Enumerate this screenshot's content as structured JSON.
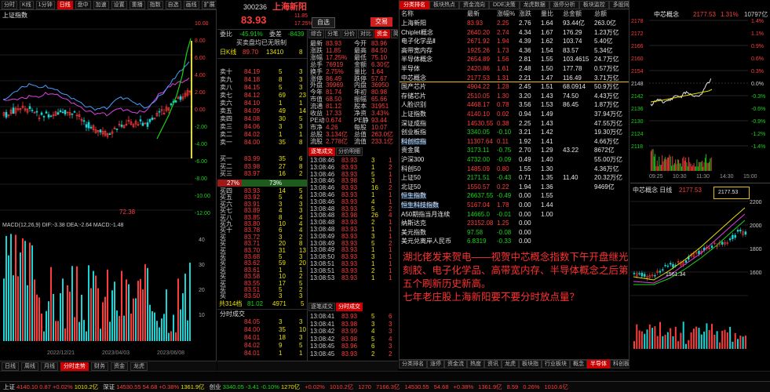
{
  "left": {
    "toolbar": [
      "分时",
      "K线",
      "1分钟",
      "日线",
      "盘中",
      "加速",
      "设置",
      "重播",
      "指数",
      "自选",
      "画线",
      "扩展",
      "分析"
    ],
    "chart_title": "上证指数",
    "scale_right": [
      "10.00",
      "8.00",
      "6.00",
      "4.00",
      "2.00",
      "0.00",
      "-2.00",
      "-4.00",
      "-6.00",
      "-8.00",
      "-10.00",
      "-12.00"
    ],
    "low_label": "72.38",
    "indicator_line": "MACD(12,26,9)  DIF:-3.38  DEA:-2.64  MACD:-1.48",
    "vol_scale": [
      "40",
      "30",
      "20",
      "10"
    ],
    "date_row": [
      "2022/12/21",
      "2023/04/03",
      "2023/06/08"
    ],
    "bottom_tabs": [
      "日线",
      "周线",
      "月线",
      "分时走势",
      "财务",
      "资金",
      "龙虎"
    ]
  },
  "quote": {
    "code": "300236",
    "name": "上海新阳",
    "price": "83.93",
    "change": "11.85",
    "pct": "17.25%",
    "btn_add": "自选",
    "btn_trade": "交易",
    "sub_tabs": [
      "综合",
      "分笔",
      "分价",
      "对比",
      "资金",
      "简况"
    ],
    "ratio_label": "委比",
    "ratio_value": "-45.91%",
    "diff_label": "委差",
    "diff_value": "-8439",
    "top_note": "买卖盘均已无限制",
    "kline_label": "日K线",
    "kline_val": "89.70",
    "kline_vol": "13410",
    "kline_n": "8",
    "asks": [
      {
        "l": "卖十",
        "p": "84.19",
        "v": "5",
        "n": "3"
      },
      {
        "l": "卖九",
        "p": "84.18",
        "v": "8",
        "n": "3"
      },
      {
        "l": "卖八",
        "p": "84.15",
        "v": "5",
        "n": "3"
      },
      {
        "l": "卖七",
        "p": "84.12",
        "v": "69",
        "n": "23"
      },
      {
        "l": "卖六",
        "p": "84.10",
        "v": "1",
        "n": "1"
      },
      {
        "l": "卖五",
        "p": "84.09",
        "v": "49",
        "n": "14"
      },
      {
        "l": "卖四",
        "p": "84.08",
        "v": "30",
        "n": "5"
      },
      {
        "l": "卖三",
        "p": "84.06",
        "v": "3",
        "n": "3"
      },
      {
        "l": "卖二",
        "p": "84.02",
        "v": "1",
        "n": "1"
      },
      {
        "l": "卖一",
        "p": "84.00",
        "v": "35",
        "n": "8"
      }
    ],
    "mid": [
      {
        "l": "买一",
        "p": "83.99",
        "v": "35",
        "n": "6"
      },
      {
        "l": "买二",
        "p": "83.98",
        "v": "27",
        "n": "8"
      },
      {
        "l": "买三",
        "p": "83.97",
        "v": "16",
        "n": "2"
      }
    ],
    "pct_left": "27%",
    "pct_right": "73%",
    "bids": [
      {
        "l": "买四",
        "p": "83.93",
        "v": "14",
        "n": "5"
      },
      {
        "l": "买五",
        "p": "83.92",
        "v": "5",
        "n": "4"
      },
      {
        "l": "买六",
        "p": "83.91",
        "v": "3",
        "n": "3"
      },
      {
        "l": "买七",
        "p": "83.89",
        "v": "4",
        "n": "3"
      },
      {
        "l": "买八",
        "p": "83.85",
        "v": "8",
        "n": "4"
      },
      {
        "l": "买九",
        "p": "83.80",
        "v": "10",
        "n": "4"
      },
      {
        "l": "买十",
        "p": "83.78",
        "v": "6",
        "n": "4"
      },
      {
        "l": "买",
        "p": "83.72",
        "v": "3",
        "n": "2"
      },
      {
        "l": "买",
        "p": "83.71",
        "v": "20",
        "n": "8"
      },
      {
        "l": "买",
        "p": "83.70",
        "v": "31",
        "n": "13"
      },
      {
        "l": "买",
        "p": "83.68",
        "v": "5",
        "n": "3"
      },
      {
        "l": "买",
        "p": "83.62",
        "v": "59",
        "n": "20"
      },
      {
        "l": "买",
        "p": "83.61",
        "v": "1",
        "n": "1"
      },
      {
        "l": "买",
        "p": "83.58",
        "v": "10",
        "n": "2"
      },
      {
        "l": "买",
        "p": "83.55",
        "v": "17",
        "n": "5"
      },
      {
        "l": "买",
        "p": "83.51",
        "v": "5",
        "n": "2"
      },
      {
        "l": "买",
        "p": "83.50",
        "v": "3",
        "n": "3"
      }
    ],
    "total_label": "共314档",
    "total_p": "81.02",
    "total_v": "4971",
    "total_n": "5",
    "stats": [
      {
        "a": "最新",
        "b": "83.93",
        "c": "今开",
        "d": "83.96"
      },
      {
        "a": "涨跌",
        "b": "11.85",
        "c": "最高",
        "d": "84.50"
      },
      {
        "a": "涨幅",
        "b": "17.25%",
        "c": "最低",
        "d": "75.10"
      },
      {
        "a": "总手",
        "b": "76919",
        "c": "金额",
        "d": "6.30亿"
      },
      {
        "a": "换手",
        "b": "2.75%",
        "c": "量比",
        "d": "1.64"
      },
      {
        "a": "涨停",
        "b": "86.49",
        "c": "跌停",
        "d": "57.67"
      },
      {
        "a": "外盘",
        "b": "39969",
        "c": "内盘",
        "d": "36950"
      },
      {
        "a": "今年",
        "b": "81.74",
        "c": "年初",
        "d": "80.98"
      },
      {
        "a": "市值",
        "b": "68.50",
        "c": "振幅",
        "d": "65.66"
      },
      {
        "a": "流通",
        "b": "81.12",
        "c": "股本",
        "d": "31951"
      },
      {
        "a": "收益",
        "b": "17.33",
        "c": "净资",
        "d": "3.43%"
      },
      {
        "a": "PE动",
        "b": "0.674",
        "c": "PE静",
        "d": "93.44"
      },
      {
        "a": "市净",
        "b": "4.26",
        "c": "每股",
        "d": "10.07"
      },
      {
        "a": "总股",
        "b": "3.134亿",
        "c": "总值",
        "d": "263.0亿"
      },
      {
        "a": "流股",
        "b": "2.778亿",
        "c": "流值",
        "d": "233.1亿"
      }
    ],
    "detail_tabs": [
      "逐笔成交",
      "分价明细"
    ],
    "ticks": [
      {
        "t": "13:08:46",
        "p": "83.93",
        "v": "3",
        "n": "1"
      },
      {
        "t": "13:08:46",
        "p": "83.93",
        "v": "1",
        "n": "2"
      },
      {
        "t": "13:08:46",
        "p": "83.93",
        "v": "5",
        "n": "1"
      },
      {
        "t": "13:08:46",
        "p": "83.98",
        "v": "3",
        "n": "1"
      },
      {
        "t": "13:08:46",
        "p": "83.93",
        "v": "16",
        "n": "2"
      },
      {
        "t": "13:08:46",
        "p": "83.93",
        "v": "1",
        "n": "1"
      },
      {
        "t": "13:08:46",
        "p": "83.93",
        "v": "4",
        "n": "1"
      },
      {
        "t": "13:08:48",
        "p": "83.93",
        "v": "5",
        "n": "2"
      },
      {
        "t": "13:08:48",
        "p": "83.98",
        "v": "26",
        "n": "4"
      },
      {
        "t": "13:08:48",
        "p": "83.93",
        "v": "2",
        "n": "1"
      },
      {
        "t": "13:08:48",
        "p": "83.93",
        "v": "1",
        "n": "1"
      },
      {
        "t": "13:08:49",
        "p": "83.93",
        "v": "3",
        "n": "1"
      },
      {
        "t": "13:08:49",
        "p": "83.93",
        "v": "5",
        "n": "2"
      },
      {
        "t": "13:08:49",
        "p": "83.93",
        "v": "1",
        "n": "1"
      },
      {
        "t": "13:08:50",
        "p": "83.93",
        "v": "3",
        "n": "1"
      },
      {
        "t": "13:08:51",
        "p": "83.93",
        "v": "1",
        "n": "1"
      },
      {
        "t": "13:08:51",
        "p": "83.93",
        "v": "2",
        "n": "1"
      },
      {
        "t": "13:08:53",
        "p": "83.93",
        "v": "1",
        "n": "1"
      }
    ],
    "big_tabs": [
      "逐笔成交",
      "分时成交"
    ],
    "big_ticks": [
      {
        "t": "13:08:41",
        "p": "83.93",
        "v": "5",
        "n": "6"
      },
      {
        "t": "13:08:41",
        "p": "83.98",
        "v": "3",
        "n": "3"
      },
      {
        "t": "13:08:42",
        "p": "83.99",
        "v": "4",
        "n": "3"
      },
      {
        "t": "13:08:42",
        "p": "83.98",
        "v": "5",
        "n": "4"
      },
      {
        "t": "13:08:45",
        "p": "83.96",
        "v": "6",
        "n": "3"
      },
      {
        "t": "13:08:45",
        "p": "83.93",
        "v": "2",
        "n": "2"
      },
      {
        "t": "13:08:46",
        "p": "83.93",
        "v": "8",
        "n": "3"
      },
      {
        "t": "13:08:46",
        "p": "83.93",
        "v": "3",
        "n": "4"
      },
      {
        "t": "13:08:47",
        "p": "83.93",
        "v": "4",
        "n": "2"
      },
      {
        "t": "13:08:48",
        "p": "83.93",
        "v": "2",
        "n": "1"
      },
      {
        "t": "13:08:50",
        "p": "83.93",
        "v": "5",
        "n": "3"
      },
      {
        "t": "13:08:53",
        "p": "83.93",
        "v": "1",
        "n": "1"
      }
    ],
    "sub_list_header": "分时成交",
    "sub_list": [
      {
        "t": "13:08",
        "p": "84.05",
        "v": "3",
        "n": "3"
      },
      {
        "t": "13:08",
        "p": "84.00",
        "v": "35",
        "n": "10"
      },
      {
        "t": "13:08",
        "p": "84.01",
        "v": "18",
        "n": "3"
      },
      {
        "t": "13:08",
        "p": "84.02",
        "v": "9",
        "n": "5"
      },
      {
        "t": "13:08",
        "p": "84.01",
        "v": "1",
        "n": "1"
      },
      {
        "t": "13:08",
        "p": "84.01",
        "v": "3",
        "n": "5"
      },
      {
        "t": "13:08",
        "p": "84.03",
        "v": "3",
        "n": "5"
      },
      {
        "t": "13:08",
        "p": "84.04",
        "v": "2",
        "n": "1"
      }
    ]
  },
  "sector": {
    "tabs": [
      "分类排名",
      "板块热点",
      "资金流向",
      "DDE决策",
      "龙虎数据",
      "涨停分析",
      "板块监控",
      "多股同列"
    ],
    "headers": [
      "名称",
      "最新",
      "涨幅%",
      "涨跌",
      "量比",
      "总金额",
      "总额"
    ],
    "rows": [
      {
        "name": "上海新阳",
        "last": "83.93",
        "pct": "2.25",
        "chg": "2.76",
        "ratio": "1.64",
        "amt": "93.44亿",
        "tot": "263.0亿",
        "hl": true
      },
      {
        "name": "Chiplet概念",
        "last": "2640.20",
        "pct": "2.74",
        "chg": "4.34",
        "ratio": "1.67",
        "amt": "176.29",
        "tot": "1.23万亿",
        "hl": true
      },
      {
        "name": "电子化学品Ⅱ",
        "last": "2671.92",
        "pct": "1.94",
        "chg": "4.39",
        "ratio": "1.62",
        "amt": "103.74",
        "tot": "5.40亿",
        "hl": true
      },
      {
        "name": "高带宽内存",
        "last": "1925.26",
        "pct": "1.73",
        "chg": "4.36",
        "ratio": "1.54",
        "amt": "83.57",
        "tot": "5.34亿",
        "hl": true
      },
      {
        "name": "半导体概念",
        "last": "2654.89",
        "pct": "1.56",
        "chg": "2.81",
        "ratio": "1.55",
        "amt": "103.4615",
        "tot": "24.7万亿",
        "hl": true
      },
      {
        "name": "半导体",
        "last": "2420.86",
        "pct": "1.61",
        "chg": "2.48",
        "ratio": "1.50",
        "amt": "177.78",
        "tot": "0.57万亿",
        "hl": true
      },
      {
        "name": "中芯概念",
        "last": "2177.53",
        "pct": "1.31",
        "chg": "2.21",
        "ratio": "1.47",
        "amt": "116.49",
        "tot": "3.71万亿",
        "hl": true
      },
      {
        "name": "国产芯片",
        "last": "4904.22",
        "pct": "1.28",
        "chg": "2.45",
        "ratio": "1.51",
        "amt": "68.0914",
        "tot": "50.9万亿",
        "hl": false
      },
      {
        "name": "存储芯片",
        "last": "2510.05",
        "pct": "1.30",
        "chg": "3.20",
        "ratio": "1.43",
        "amt": "74.50",
        "tot": "4.43万亿",
        "hl": false
      },
      {
        "name": "人脸识别",
        "last": "4468.17",
        "pct": "0.78",
        "chg": "3.56",
        "ratio": "1.53",
        "amt": "86.45",
        "tot": "1.87万亿",
        "hl": false
      },
      {
        "name": "上证指数",
        "last": "4140.10",
        "pct": "0.02",
        "chg": "0.94",
        "ratio": "1.49",
        "amt": "",
        "tot": "37.94万亿",
        "hl": false
      },
      {
        "name": "深证成指",
        "last": "14530.55",
        "pct": "0.38",
        "chg": "2.25",
        "ratio": "1.43",
        "amt": "",
        "tot": "47.55万亿",
        "hl": false
      },
      {
        "name": "创业板指",
        "last": "3340.05",
        "pct": "-0.10",
        "chg": "3.21",
        "ratio": "1.42",
        "amt": "",
        "tot": "19.30万亿",
        "hl": false
      },
      {
        "name": "科创综指",
        "last": "11307.64",
        "pct": "0.11",
        "chg": "1.92",
        "ratio": "1.41",
        "amt": "",
        "tot": "4.66万亿",
        "hl": false
      },
      {
        "name": "贵金属",
        "last": "3173.11",
        "pct": "-0.75",
        "chg": "2.70",
        "ratio": "1.29",
        "amt": "43.22",
        "tot": "8672亿",
        "hl": false
      },
      {
        "name": "沪深300",
        "last": "4732.00",
        "pct": "-0.09",
        "chg": "0.49",
        "ratio": "1.40",
        "amt": "",
        "tot": "55.00万亿",
        "hl": false
      },
      {
        "name": "科创50",
        "last": "1485.09",
        "pct": "0.80",
        "chg": "1.55",
        "ratio": "1.30",
        "amt": "",
        "tot": "4.36万亿",
        "hl": false
      },
      {
        "name": "上证50",
        "last": "2171.51",
        "pct": "-0.43",
        "chg": "0.71",
        "ratio": "1.35",
        "amt": "11.40",
        "tot": "20.32万亿",
        "hl": false
      },
      {
        "name": "北证50",
        "last": "1550.57",
        "pct": "0.22",
        "chg": "1.94",
        "ratio": "1.36",
        "amt": "",
        "tot": "9469亿",
        "hl": false
      },
      {
        "name": "恒生指数",
        "last": "26637.55",
        "pct": "-0.49",
        "chg": "0.00",
        "ratio": "1.55",
        "amt": "",
        "tot": "",
        "hl": false
      },
      {
        "name": "恒生科技指数",
        "last": "5167.04",
        "pct": "1.78",
        "chg": "0.00",
        "ratio": "1.44",
        "amt": "",
        "tot": "",
        "hl": false
      },
      {
        "name": "A50期指当月连续",
        "last": "14665.0",
        "pct": "-0.01",
        "chg": "0.00",
        "ratio": "1.00",
        "amt": "",
        "tot": "",
        "hl": false
      },
      {
        "name": "纳斯达克",
        "last": "23152.08",
        "pct": "1.25",
        "chg": "0.00",
        "ratio": "",
        "amt": "",
        "tot": "",
        "hl": false
      },
      {
        "name": "美元指数",
        "last": "97.58",
        "pct": "-0.08",
        "chg": "0.00",
        "ratio": "",
        "amt": "",
        "tot": "",
        "hl": false
      },
      {
        "name": "美元兑离岸人民币",
        "last": "6.8319",
        "pct": "-0.33",
        "chg": "0.00",
        "ratio": "",
        "amt": "",
        "tot": "",
        "hl": false
      }
    ],
    "annotation": [
      "湖北佬发来贺电——视贺中芯概念指数下午开盘继光",
      "刻胶、电子化学品、高带宽内存、半导体概念之后第",
      "五个刷新历史新高。",
      "七年老庄股上海新阳要不要分时放点量？"
    ],
    "bottom_tabs": [
      "分类排名",
      "涨停",
      "资金流",
      "热度",
      "资讯",
      "龙虎",
      "板块指",
      "行业板块",
      "概念",
      "半导体",
      "科创板",
      "国防军工",
      "北交所",
      "更多"
    ],
    "active_bottom": "半导体"
  },
  "mini": {
    "title": "中芯概念",
    "value": "2177.53",
    "pct": "1.31%",
    "vol": "10797亿",
    "left_scale": [
      "2178",
      "2172",
      "2166",
      "2160",
      "2154",
      "2148",
      "2142",
      "2136",
      "2130",
      "2124",
      "2118"
    ],
    "right_scale": [
      "1.4%",
      "1.1%",
      "0.9%",
      "0.6%",
      "0.3%",
      "0.0%",
      "-0.3%",
      "-0.6%",
      "-0.9%",
      "-1.2%",
      "-1.4%"
    ],
    "time_labels": [
      "09:25",
      "10:30",
      "11:30",
      "14:30",
      "15:00"
    ],
    "k_title": "中芯概念  日线",
    "k_value": "2177.53",
    "k_high_label": "2177.53",
    "k_low": "1561.34",
    "k_scale": [
      "2200",
      "2000",
      "1800",
      "1600"
    ]
  },
  "statusbar": [
    {
      "name": "上证",
      "val": "4140.10",
      "chg": "0.87",
      "pct": "+0.02%",
      "amt": "1010.2亿"
    },
    {
      "name": "深证",
      "val": "14530.55",
      "chg": "54.68",
      "pct": "+0.38%",
      "amt": "1361.9亿"
    },
    {
      "name": "创业",
      "val": "3340.05",
      "chg": "-3.41",
      "pct": "-0.10%",
      "amt": "1270亿"
    }
  ],
  "statusbar_right": [
    "+0.02%",
    "1010.2亿",
    "1270",
    "7166.3亿",
    "14530.55",
    "54.68",
    "+0.38%",
    "1361.9亿",
    "8.59",
    "0.26%",
    "1010.6亿"
  ]
}
